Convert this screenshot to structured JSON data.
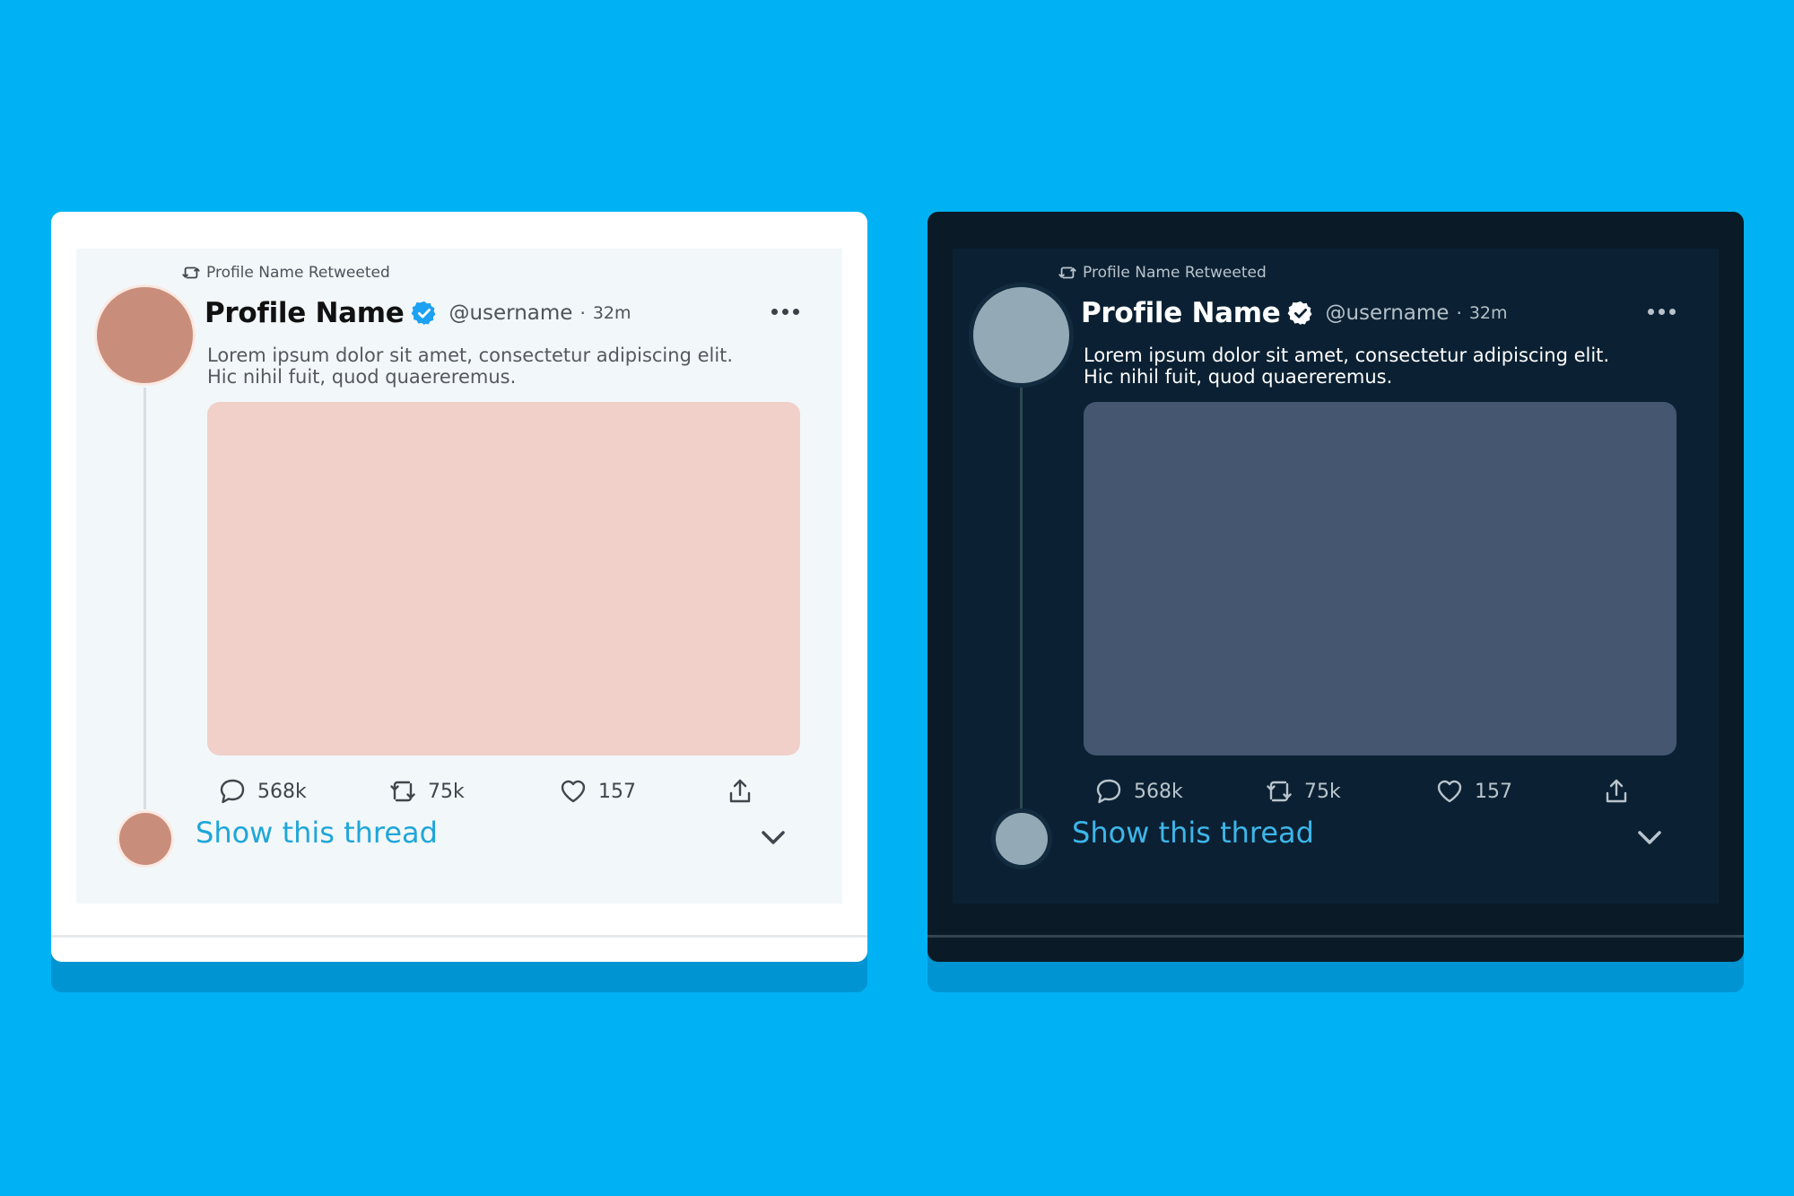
{
  "background_color": "#00b2f3",
  "cards": [
    {
      "theme": "light",
      "retweet_header": "Profile Name Retweeted",
      "profile_name": "Profile Name",
      "verified": true,
      "handle": "@username",
      "separator": "·",
      "time": "32m",
      "text_lines": [
        "Lorem ipsum dolor sit amet, consectetur adipiscing elit.",
        "Hic nihil fuit, quod quaereremus."
      ],
      "actions": {
        "replies": "568k",
        "retweets": "75k",
        "likes": "157"
      },
      "show_thread_label": "Show this thread",
      "colors": {
        "avatar": "#c98e7b",
        "media": "#f0d0c9",
        "verified_badge": "#1da1f2",
        "accent": "#1fa6d8"
      }
    },
    {
      "theme": "dark",
      "retweet_header": "Profile Name Retweeted",
      "profile_name": "Profile Name",
      "verified": true,
      "handle": "@username",
      "separator": "·",
      "time": "32m",
      "text_lines": [
        "Lorem ipsum dolor sit amet, consectetur adipiscing elit.",
        "Hic nihil fuit, quod quaereremus."
      ],
      "actions": {
        "replies": "568k",
        "retweets": "75k",
        "likes": "157"
      },
      "show_thread_label": "Show this thread",
      "colors": {
        "avatar": "#94a9b6",
        "media": "#445670",
        "verified_badge": "#ffffff",
        "accent": "#3eb6ea"
      }
    }
  ],
  "icons": {
    "retweet_header": "retweet-icon",
    "verified": "verified-badge-icon",
    "more": "more-dots-icon",
    "reply": "comment-icon",
    "retweet": "retweet-icon",
    "like": "heart-icon",
    "share": "share-icon",
    "expand": "chevron-down-icon"
  }
}
